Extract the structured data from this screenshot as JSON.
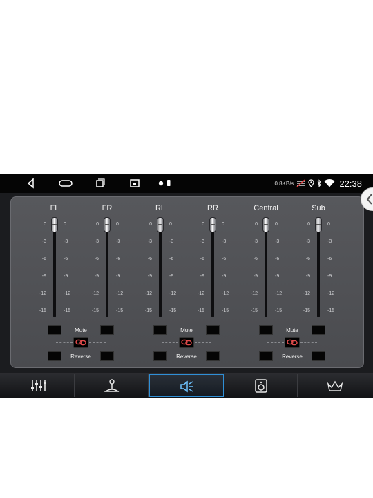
{
  "status_bar": {
    "net_speed": "0.8KB/s",
    "time": "22:38",
    "nav_icons": [
      "back-icon",
      "home-icon",
      "recent-apps-icon",
      "screenshot-icon"
    ],
    "indicator_icons": [
      "dot-icon",
      "battery-small-icon"
    ],
    "status_icons": [
      "no-signal-icon",
      "location-icon",
      "bluetooth-icon",
      "wifi-icon"
    ]
  },
  "ticks": [
    "0",
    "-3",
    "-6",
    "-9",
    "-12",
    "-15"
  ],
  "channels": [
    {
      "label": "FL"
    },
    {
      "label": "FR"
    },
    {
      "label": "RL"
    },
    {
      "label": "RR"
    },
    {
      "label": "Central"
    },
    {
      "label": "Sub"
    }
  ],
  "pairs": [
    {
      "mute_label": "Mute",
      "reverse_label": "Reverse"
    },
    {
      "mute_label": "Mute",
      "reverse_label": "Reverse"
    },
    {
      "mute_label": "Mute",
      "reverse_label": "Reverse"
    }
  ],
  "bottom_tabs": [
    {
      "icon": "equalizer-icon"
    },
    {
      "icon": "joystick-icon"
    },
    {
      "icon": "speaker-volume-icon",
      "active": true
    },
    {
      "icon": "speaker-box-icon"
    },
    {
      "icon": "crown-icon"
    }
  ],
  "colors": {
    "active_tab": "#2f8fd6",
    "panel": "#505155"
  }
}
